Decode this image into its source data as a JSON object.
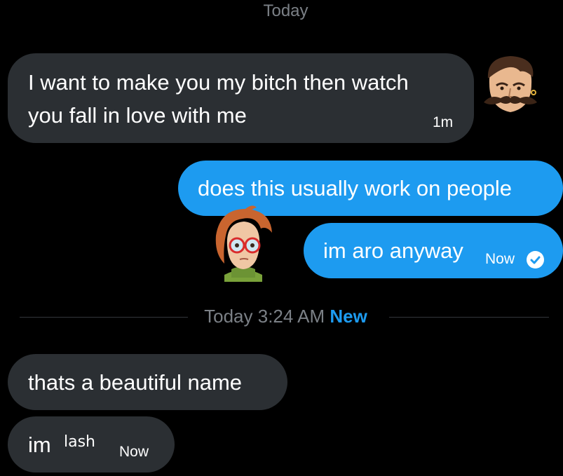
{
  "header": {
    "day_label": "Today"
  },
  "colors": {
    "background": "#000000",
    "incoming_bubble": "#2b2f33",
    "outgoing_bubble": "#1d9bf0",
    "muted_text": "#7b8086",
    "accent": "#1d9bf0"
  },
  "messages_before": [
    {
      "sender": "them",
      "lines": [
        "I want to make you my bitch then watch",
        "you fall in love with me"
      ],
      "time": "1m",
      "avatar_icon": "mustache-man-avatar-icon"
    },
    {
      "sender": "me",
      "text": "does this usually work on people"
    },
    {
      "sender": "me",
      "text": "im aro anyway",
      "time": "Now",
      "read_icon": "read-check-icon",
      "avatar_icon": "red-haired-glasses-avatar-icon"
    }
  ],
  "divider": {
    "time": "Today 3:24 AM",
    "new_label": "New"
  },
  "messages_after": [
    {
      "sender": "them",
      "text": "thats a beautiful name"
    },
    {
      "sender": "them",
      "text": "im",
      "handwritten": "lash",
      "time": "Now"
    }
  ]
}
